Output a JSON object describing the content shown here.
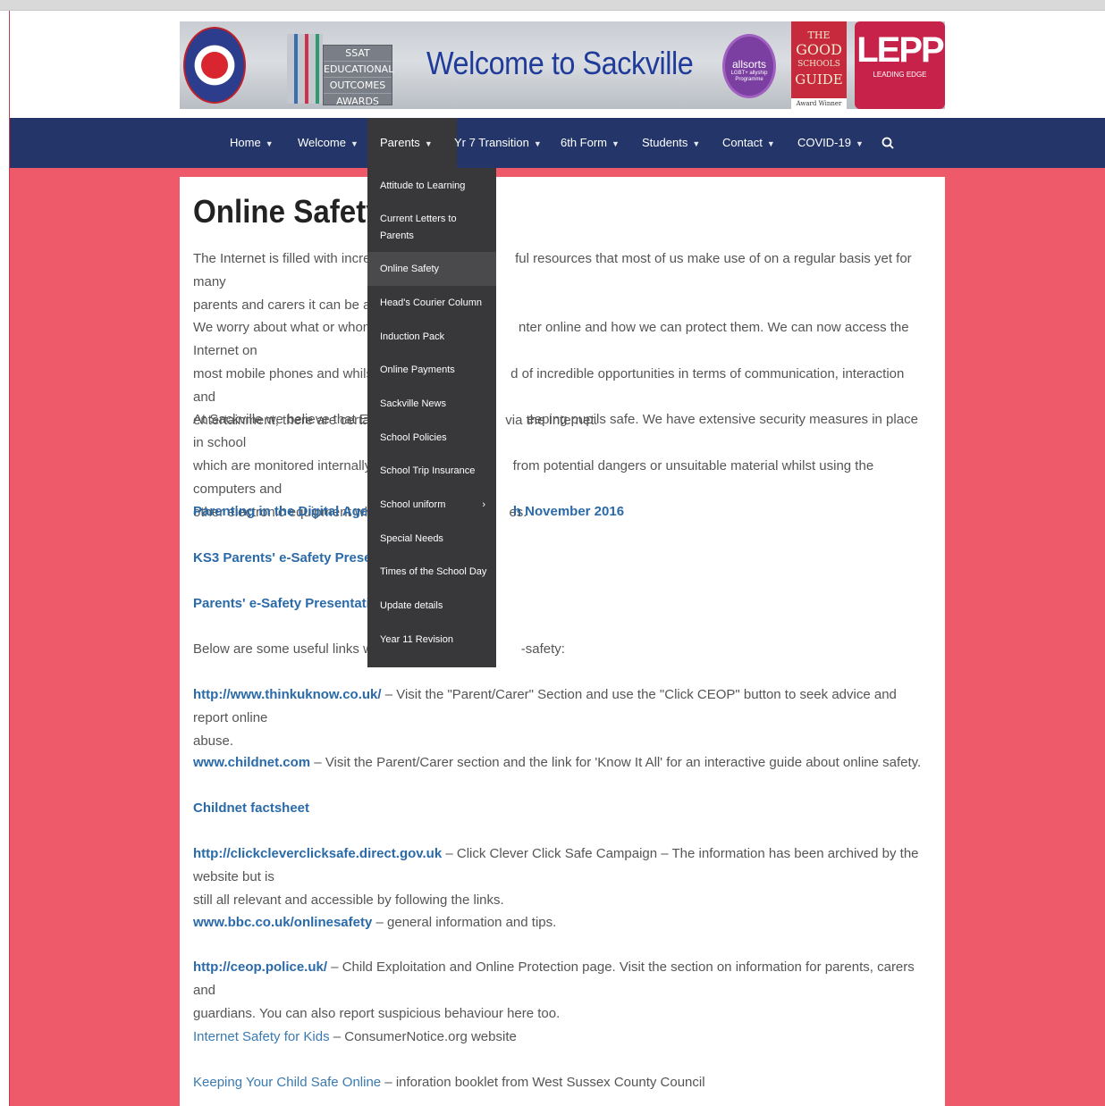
{
  "banner": {
    "ssat": [
      "SSAT",
      "EDUCATIONAL",
      "OUTCOMES",
      "AWARDS 2019"
    ],
    "title": "Welcome to Sackville",
    "allsorts": "allsorts",
    "allsorts_sub": "LGBT+ allyship Programme",
    "good_guide": [
      "THE",
      "GOOD",
      "SCHOOLS",
      "GUIDE"
    ],
    "good_guide_award": "Award Winner",
    "lepp_mark": "LEPP",
    "lepp_sub": "LEADING EDGE"
  },
  "nav": {
    "items": [
      "Home",
      "Welcome",
      "Parents",
      "Yr 7 Transition",
      "6th Form",
      "Students",
      "Contact",
      "COVID-19"
    ],
    "search_icon": "search-icon"
  },
  "dropdown": {
    "items": [
      "Attitude to Learning",
      "Current Letters to Parents",
      "Online Safety",
      "Head's Courier Column",
      "Induction Pack",
      "Online Payments",
      "Sackville News",
      "School Policies",
      "School Trip Insurance",
      "School uniform",
      "Special Needs",
      "Times of the School Day",
      "Update details",
      "Year 11 Revision"
    ],
    "submenu_arrow": "›"
  },
  "content": {
    "title": "Online Safety",
    "para1_a": "The Internet is filled with incredi",
    "para1_b": "ful resources that most of us make use of on a regular basis yet for many",
    "para1_c": "parents and carers it can be a pl",
    "para2_a": "We worry about what or whom c",
    "para2_b": "nter online and how we can protect them. We can now access the Internet on",
    "para2_c": "most mobile phones and whilst",
    "para2_d": "d of incredible opportunities in terms of communication, interaction and",
    "para2_e": "entertainment, there are certain",
    "para2_f": "via the Internet.",
    "para3_a": "At Sackville we believe that E-Saf",
    "para3_b": "eeping pupils safe. We have extensive security measures in place in school",
    "para3_c": "which are monitored internally t",
    "para3_d": "from potential dangers or unsuitable material whilst using the computers and",
    "para3_e": "other electronic equipment whi",
    "para3_f": "es.",
    "link_parenting_a": "Parenting in the Digital Age –",
    "link_parenting_b": "h November 2016",
    "link_ks3": "KS3 Parents' e-Safety Presenta",
    "link_parents": "Parents' e-Safety Presentation",
    "below_a": "Below are some useful links with",
    "below_b": "-safety:",
    "thinkuknow_link": "http://www.thinkuknow.co.uk/",
    "thinkuknow_text": " – Visit the \"Parent/Carer\" Section and use the \"Click CEOP\" button to seek advice and report online",
    "thinkuknow_text2": "abuse.",
    "childnet_link": "www.childnet.com",
    "childnet_text": " – Visit the Parent/Carer section and the link for 'Know It All' for an interactive guide about online safety.",
    "childnet_factsheet": "Childnet factsheet",
    "clickclever_link": "http://clickcleverclicksafe.direct.gov.uk",
    "clickclever_text": " – Click Clever Click Safe Campaign – The information has been archived by the website but is",
    "clickclever_text2": "still all relevant and accessible by following the links.",
    "bbc_link": "www.bbc.co.uk/onlinesafety",
    "bbc_text": " – general information and tips.",
    "ceop_link": "http://ceop.police.uk/",
    "ceop_text": " – Child Exploitation and Online Protection page. Visit the section on information for parents, carers and",
    "ceop_text2": "guardians. You can also report suspicious behaviour here too.",
    "kids_link": "Internet Safety for Kids",
    "kids_text": " – ConsumerNotice.org website",
    "keeping_link": "Keeping Your Child Safe Online",
    "keeping_text": " – inforation booklet from West Sussex County Council"
  }
}
